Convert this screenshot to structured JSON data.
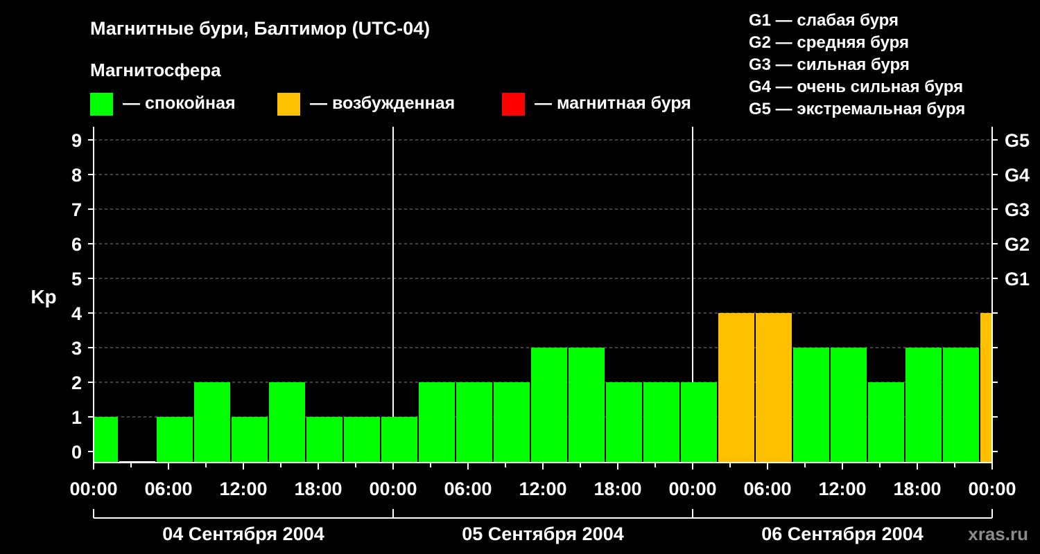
{
  "colors": {
    "background": "#000000",
    "text": "#ffffff",
    "calm": "#00ff00",
    "disturbed": "#ffc000",
    "storm": "#ff0000",
    "grid": "#888888",
    "credit": "#8c8c8c"
  },
  "header": {
    "title": "Магнитные бури, Балтимор (UTC-04)",
    "legend_title": "Магнитосфера",
    "legend": [
      {
        "key": "calm",
        "label": "— спокойная"
      },
      {
        "key": "disturbed",
        "label": "— возбужденная"
      },
      {
        "key": "storm",
        "label": "— магнитная буря"
      }
    ],
    "storm_levels": [
      "G1 — слабая буря",
      "G2 — средняя буря",
      "G3 — сильная буря",
      "G4 — очень сильная буря",
      "G5 — экстремальная буря"
    ]
  },
  "credit": "xras.ru",
  "chart_data": {
    "type": "bar",
    "ylabel": "Kp",
    "ylim": [
      0,
      9
    ],
    "y_ticks": [
      0,
      1,
      2,
      3,
      4,
      5,
      6,
      7,
      8,
      9
    ],
    "right_axis_labels": [
      {
        "kp": 5,
        "label": "G1"
      },
      {
        "kp": 6,
        "label": "G2"
      },
      {
        "kp": 7,
        "label": "G3"
      },
      {
        "kp": 8,
        "label": "G4"
      },
      {
        "kp": 9,
        "label": "G5"
      }
    ],
    "grid_y": true,
    "x_range_hours": [
      0,
      72
    ],
    "x_tick_labels": [
      "00:00",
      "06:00",
      "12:00",
      "18:00",
      "00:00",
      "06:00",
      "12:00",
      "18:00",
      "00:00",
      "06:00",
      "12:00",
      "18:00",
      "00:00"
    ],
    "days": [
      "04 Сентября 2004",
      "05 Сентября 2004",
      "06 Сентября 2004"
    ],
    "bars": [
      {
        "start": 0,
        "end": 2,
        "kp": 1,
        "status": "calm"
      },
      {
        "start": 2,
        "end": 5,
        "kp": 0,
        "status": "calm"
      },
      {
        "start": 5,
        "end": 8,
        "kp": 1,
        "status": "calm"
      },
      {
        "start": 8,
        "end": 11,
        "kp": 2,
        "status": "calm"
      },
      {
        "start": 11,
        "end": 14,
        "kp": 1,
        "status": "calm"
      },
      {
        "start": 14,
        "end": 17,
        "kp": 2,
        "status": "calm"
      },
      {
        "start": 17,
        "end": 20,
        "kp": 1,
        "status": "calm"
      },
      {
        "start": 20,
        "end": 23,
        "kp": 1,
        "status": "calm"
      },
      {
        "start": 23,
        "end": 26,
        "kp": 1,
        "status": "calm"
      },
      {
        "start": 26,
        "end": 29,
        "kp": 2,
        "status": "calm"
      },
      {
        "start": 29,
        "end": 32,
        "kp": 2,
        "status": "calm"
      },
      {
        "start": 32,
        "end": 35,
        "kp": 2,
        "status": "calm"
      },
      {
        "start": 35,
        "end": 38,
        "kp": 3,
        "status": "calm"
      },
      {
        "start": 38,
        "end": 41,
        "kp": 3,
        "status": "calm"
      },
      {
        "start": 41,
        "end": 44,
        "kp": 2,
        "status": "calm"
      },
      {
        "start": 44,
        "end": 47,
        "kp": 2,
        "status": "calm"
      },
      {
        "start": 47,
        "end": 50,
        "kp": 2,
        "status": "calm"
      },
      {
        "start": 50,
        "end": 53,
        "kp": 4,
        "status": "disturbed"
      },
      {
        "start": 53,
        "end": 56,
        "kp": 4,
        "status": "disturbed"
      },
      {
        "start": 56,
        "end": 59,
        "kp": 3,
        "status": "calm"
      },
      {
        "start": 59,
        "end": 62,
        "kp": 3,
        "status": "calm"
      },
      {
        "start": 62,
        "end": 65,
        "kp": 2,
        "status": "calm"
      },
      {
        "start": 65,
        "end": 68,
        "kp": 3,
        "status": "calm"
      },
      {
        "start": 68,
        "end": 71,
        "kp": 3,
        "status": "calm"
      },
      {
        "start": 71,
        "end": 72,
        "kp": 4,
        "status": "disturbed"
      }
    ]
  }
}
